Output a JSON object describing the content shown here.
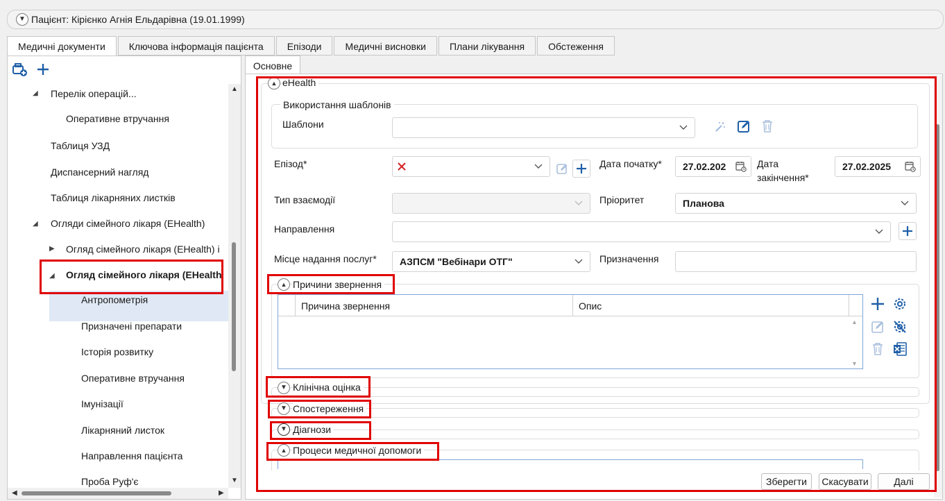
{
  "patient": {
    "label": "Пацієнт: Кірієнко Агнія Ельдарівна (19.01.1999)"
  },
  "tabs": [
    {
      "label": "Медичні документи"
    },
    {
      "label": "Ключова інформація пацієнта"
    },
    {
      "label": "Епізоди"
    },
    {
      "label": "Медичні висновки"
    },
    {
      "label": "Плани лікування"
    },
    {
      "label": "Обстеження"
    }
  ],
  "tree": {
    "items": [
      {
        "label": "Перелік операцій..."
      },
      {
        "label": "Оперативне втручання"
      },
      {
        "label": "Таблиця УЗД"
      },
      {
        "label": "Диспансерний нагляд"
      },
      {
        "label": "Таблиця лікарняних листків"
      },
      {
        "label": "Огляди сімейного лікаря (EHealth)"
      },
      {
        "label": "Огляд сімейного лікаря (EHealth) і"
      },
      {
        "label": "Огляд сімейного лікаря (EHealth"
      },
      {
        "label": "Антропометрія"
      },
      {
        "label": "Призначені препарати"
      },
      {
        "label": "Історія розвитку"
      },
      {
        "label": "Оперативне втручання"
      },
      {
        "label": "Імунізації"
      },
      {
        "label": "Лікарняний листок"
      },
      {
        "label": "Направлення пацієнта"
      },
      {
        "label": "Проба Руф'є"
      }
    ]
  },
  "subtab": {
    "label": "Основне"
  },
  "form": {
    "ehealth_label": "eHealth",
    "templates_group": "Використання шаблонів",
    "templates_label": "Шаблони",
    "templates_value": "",
    "episode_label": "Епізод*",
    "start_date_label": "Дата початку*",
    "start_date_value": "27.02.202",
    "end_date_label_1": "Дата",
    "end_date_label_2": "закінчення*",
    "end_date_value": "27.02.2025",
    "interaction_type_label": "Тип взаємодії",
    "priority_label": "Пріоритет",
    "priority_value": "Планова",
    "referral_label": "Направлення",
    "place_label": "Місце надання послуг*",
    "place_value": "АЗПСМ \"Вебінари ОТГ\"",
    "purpose_label": "Призначення"
  },
  "sections": {
    "reasons": "Причини звернення",
    "clinical": "Клінічна оцінка",
    "observations": "Спостереження",
    "diagnoses": "Діагнози",
    "processes": "Процеси медичної допомоги"
  },
  "reasons_grid": {
    "columns": [
      "Причина звернення",
      "Опис"
    ]
  },
  "buttons": {
    "save": "Зберегти",
    "cancel": "Скасувати",
    "next": "Далі"
  },
  "colors": {
    "accent": "#1f5fa8",
    "highlight": "#e00000",
    "selected_row": "#dfe8f4"
  }
}
